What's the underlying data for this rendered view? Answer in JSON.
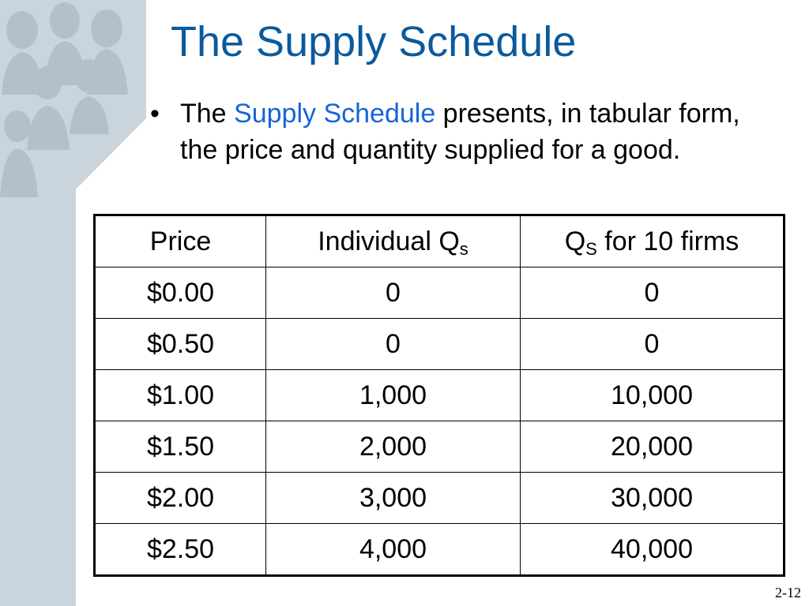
{
  "slide": {
    "title": "The Supply Schedule",
    "bullet": {
      "before": "The ",
      "highlight": "Supply Schedule",
      "after": " presents, in tabular form, the price and quantity supplied for a good."
    },
    "slide_number": "2-12"
  },
  "table": {
    "headers": {
      "price": "Price",
      "individual": "Individual Q",
      "individual_sub": "s",
      "firms_q": "Q",
      "firms_sub": "S",
      "firms_rest": " for 10 firms"
    },
    "rows": [
      [
        "$0.00",
        "0",
        "0"
      ],
      [
        "$0.50",
        "0",
        "0"
      ],
      [
        "$1.00",
        "1,000",
        "10,000"
      ],
      [
        "$1.50",
        "2,000",
        "20,000"
      ],
      [
        "$2.00",
        "3,000",
        "30,000"
      ],
      [
        "$2.50",
        "4,000",
        "40,000"
      ]
    ]
  },
  "colors": {
    "title": "#0b5a9c",
    "highlight": "#1565d8",
    "sidebar": "#c9d4dc"
  },
  "icons": {
    "sidebar": "people-silhouettes-decoration"
  }
}
